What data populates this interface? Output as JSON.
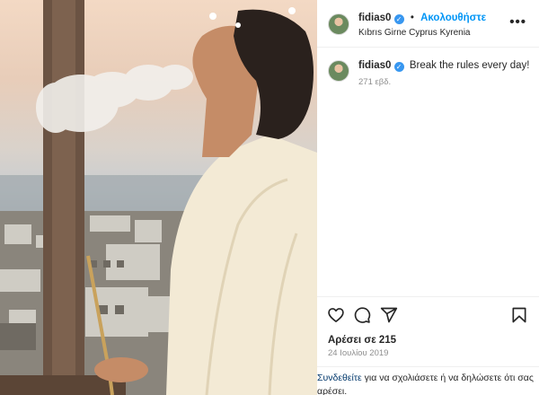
{
  "post": {
    "username": "fidias0",
    "verified_glyph": "✓",
    "follow_label": "Ακολουθήστε",
    "location": "Kıbrıs Girne Cyprus Kyrenia",
    "more_glyph": "•••",
    "caption": "Break the rules every day!",
    "caption_age": "271 εβδ.",
    "likes": "Αρέσει σε 215",
    "date": "24 Ιουλίου 2019",
    "login_link": "Συνδεθείτε",
    "login_text": " για να σχολιάσετε ή να δηλώσετε ότι σας αρέσει."
  },
  "icons": {
    "like": "heart-icon",
    "comment": "comment-icon",
    "share": "paper-plane-icon",
    "save": "bookmark-icon",
    "more": "more-options-icon",
    "verified": "verified-badge-icon"
  },
  "colors": {
    "follow": "#0095f6",
    "verified": "#3897f0",
    "muted": "#8e8e8e",
    "text": "#262626",
    "link": "#00376b"
  }
}
